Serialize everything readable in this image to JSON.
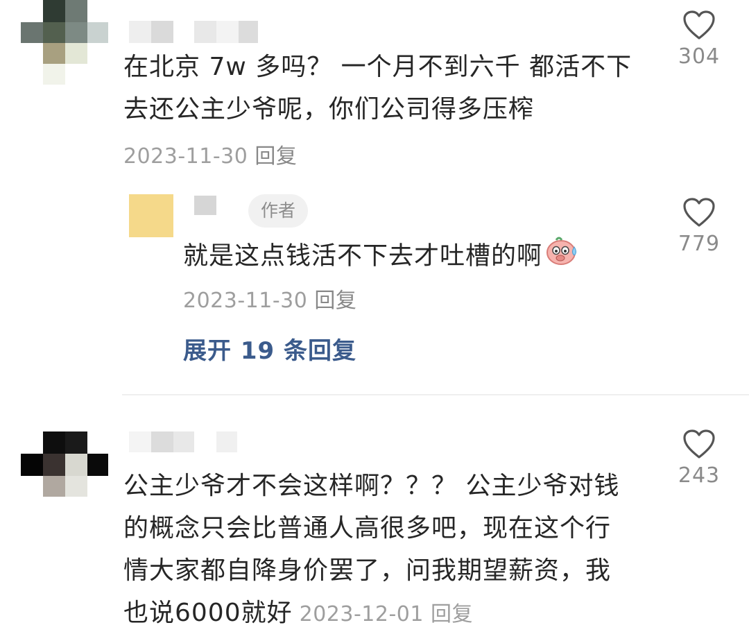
{
  "comment1": {
    "text": "在北京 7w 多吗？ 一个月不到六千 都活不下去还公主少爷呢，你们公司得多压榨",
    "line1": "在北京 7w 多吗？ 一个月不到六千 都活不下",
    "line2": "去还公主少爷呢，你们公司得多压榨",
    "date": "2023-11-30",
    "reply_label": "回复",
    "likes": "304"
  },
  "reply1": {
    "author_badge": "作者",
    "text": "就是这点钱活不下去才吐槽的啊",
    "emoji": "sweating-pig-emoji",
    "date": "2023-11-30",
    "reply_label": "回复",
    "likes": "779",
    "expand_label": "展开 19 条回复"
  },
  "comment2": {
    "line1": "公主少爷才不会这样啊？？？ 公主少爷对钱",
    "line2": "的概念只会比普通人高很多吧，现在这个行",
    "line3": "情大家都自降身价罢了，问我期望薪资，我",
    "line4": "也说6000就好",
    "date": "2023-12-01",
    "reply_label": "回复",
    "likes": "243"
  },
  "colors": {
    "text": "#262626",
    "meta": "#9e9e9e",
    "link": "#3b5b8c",
    "divider": "#efefef"
  },
  "icons": {
    "like": "heart-outline-icon"
  }
}
